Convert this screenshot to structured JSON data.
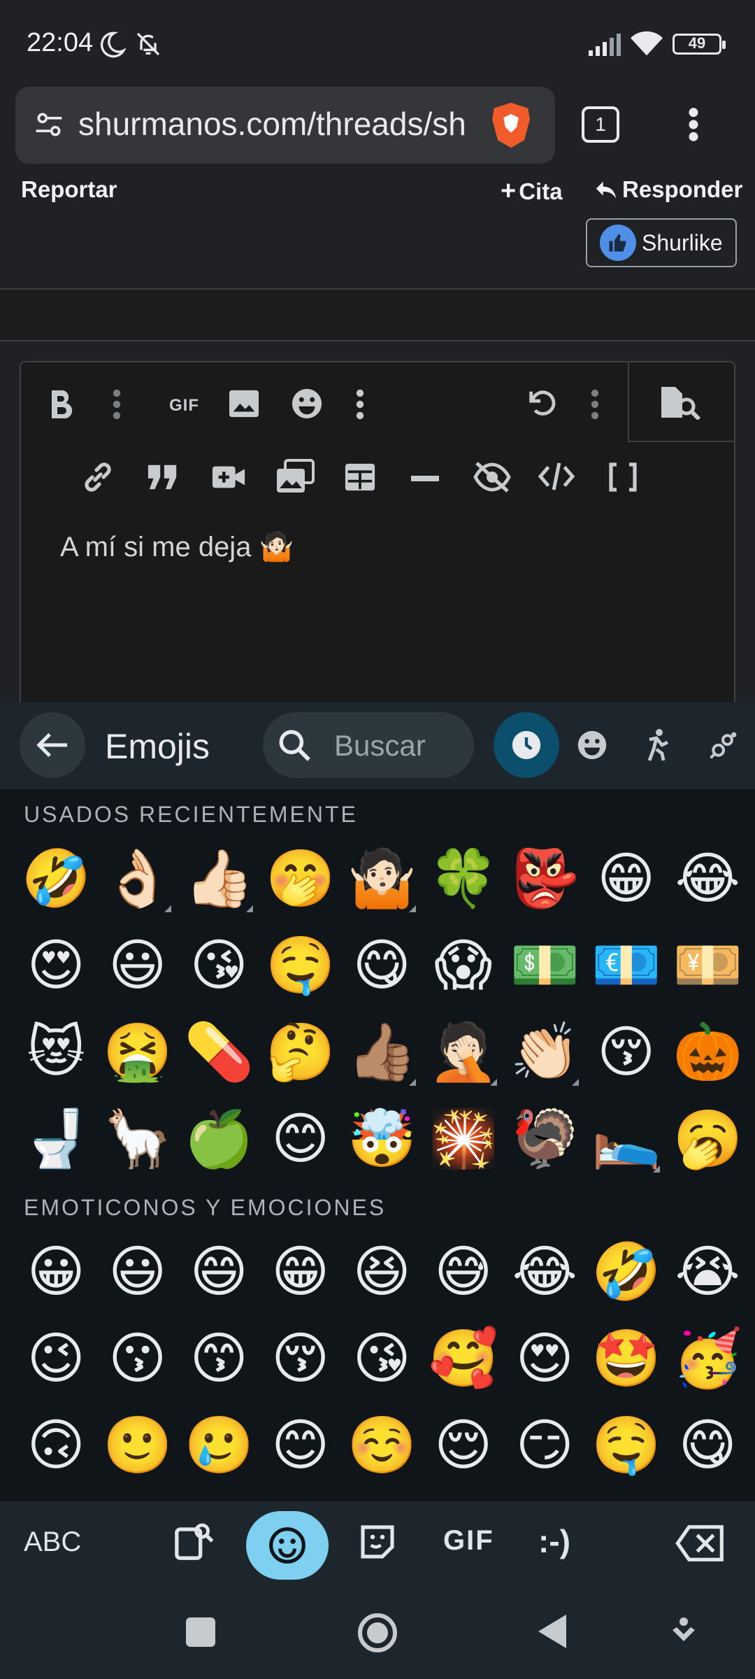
{
  "status_bar": {
    "time": "22:04",
    "battery": "49"
  },
  "browser": {
    "url": "shurmanos.com/threads/sh",
    "tab_count": "1"
  },
  "post_actions": {
    "report": "Reportar",
    "quote": "Cita",
    "reply": "Responder",
    "like": "Shurlike"
  },
  "editor": {
    "gif_label": "GIF",
    "content": "A mí si me deja 🤷🏻"
  },
  "keyboard": {
    "title": "Emojis",
    "search_placeholder": "Buscar",
    "sections": [
      {
        "title": "USADOS RECIENTEMENTE",
        "emojis": [
          "🤣",
          "👌🏻",
          "👍🏻",
          "🤭",
          "🤷🏻",
          "🍀",
          "👺",
          "😁",
          "😂",
          "😍",
          "😃",
          "😘",
          "🤤",
          "😋",
          "😱",
          "💵",
          "💶",
          "💴",
          "😻",
          "🤮",
          "💊",
          "🤔",
          "👍🏽",
          "🤦🏻",
          "👏🏻",
          "😚",
          "🎃",
          "🚽",
          "🦙",
          "🍏",
          "😊",
          "🤯",
          "🎇",
          "🦃",
          "🛌",
          "🥱"
        ]
      },
      {
        "title": "EMOTICONOS Y EMOCIONES",
        "emojis": [
          "😀",
          "😃",
          "😄",
          "😁",
          "😆",
          "😅",
          "😂",
          "🤣",
          "😭",
          "😉",
          "😗",
          "😙",
          "😚",
          "😘",
          "🥰",
          "😍",
          "🤩",
          "🥳",
          "🙃",
          "🙂",
          "🥲",
          "😊",
          "☺️",
          "😌",
          "😏",
          "🤤",
          "😋"
        ]
      }
    ],
    "bottom": {
      "abc": "ABC",
      "gif": "GIF",
      "emoticon": ":-)"
    }
  }
}
